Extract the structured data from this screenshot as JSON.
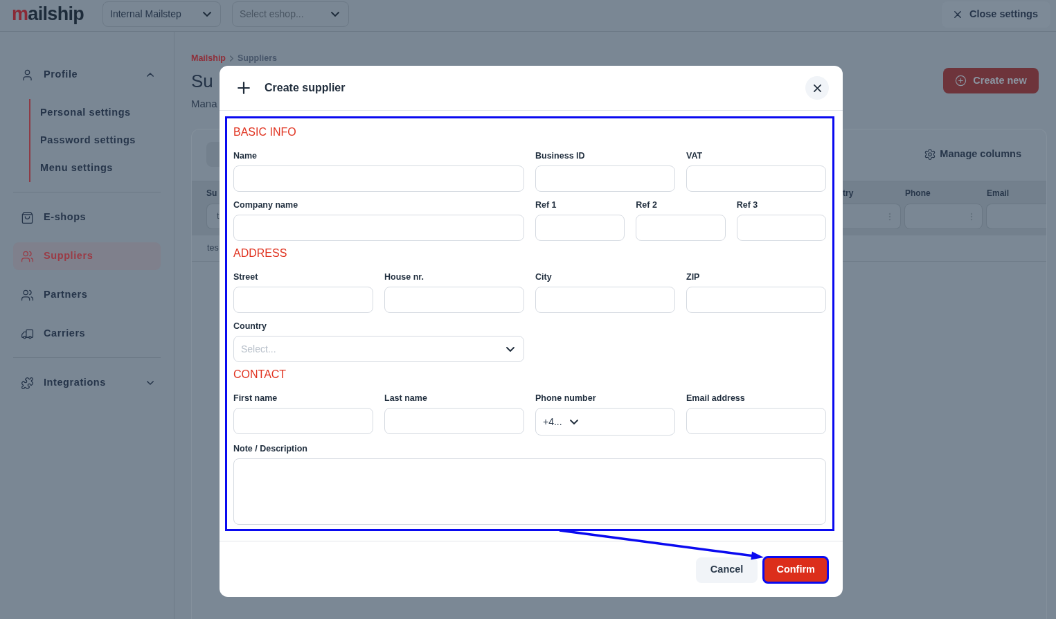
{
  "top_bar": {
    "logo": "mailship",
    "selects": [
      {
        "value": "Internal Mailstep"
      },
      {
        "placeholder": "Select eshop..."
      }
    ],
    "close_button": "Close settings"
  },
  "sidebar": {
    "sections": [
      {
        "items": [
          {
            "label": "Profile",
            "kind": "group",
            "expanded": true,
            "selected": false,
            "children": [
              {
                "label": "Personal settings",
                "selected": false
              },
              {
                "label": "Password settings",
                "selected": false
              },
              {
                "label": "Menu settings",
                "selected": false
              }
            ]
          }
        ]
      },
      {
        "items": [
          {
            "label": "E-shops",
            "kind": "link",
            "selected": false
          },
          {
            "label": "Suppliers",
            "kind": "link",
            "selected": true
          },
          {
            "label": "Partners",
            "kind": "link",
            "selected": false
          },
          {
            "label": "Carriers",
            "kind": "link",
            "selected": false
          }
        ]
      },
      {
        "items": [
          {
            "label": "Integrations",
            "kind": "group",
            "expanded": false,
            "selected": false
          }
        ]
      }
    ]
  },
  "page": {
    "breadcrumb": [
      {
        "label": "Mailship",
        "current": false
      },
      {
        "label": "Suppliers",
        "current": true
      }
    ],
    "title": "Su",
    "subtitle": "Mana",
    "create_button": "Create new",
    "manage_columns": "Manage columns",
    "table": {
      "left_columns": [
        {
          "label": "Su",
          "filter_value": "t"
        }
      ],
      "right_columns": [
        {
          "label": "try",
          "menu": true
        },
        {
          "label": "Phone",
          "menu": true
        },
        {
          "label": "Email",
          "menu": false
        }
      ],
      "rows": [
        {
          "cells": [
            "tes"
          ]
        }
      ]
    }
  },
  "modal": {
    "title": "Create supplier",
    "form_highlighted": true,
    "annotation_arrow": true,
    "sections": [
      {
        "heading": "BASIC INFO",
        "rows": [
          [
            {
              "label": "Name",
              "kind": "text"
            },
            {
              "label": "Business ID",
              "kind": "text"
            },
            {
              "label": "VAT",
              "kind": "text"
            }
          ],
          [
            {
              "label": "Company name",
              "kind": "text"
            },
            {
              "label": "Ref 1",
              "kind": "text"
            },
            {
              "label": "Ref 2",
              "kind": "text"
            },
            {
              "label": "Ref 3",
              "kind": "text"
            }
          ]
        ]
      },
      {
        "heading": "ADDRESS",
        "rows": [
          [
            {
              "label": "Street",
              "kind": "text"
            },
            {
              "label": "House nr.",
              "kind": "text"
            },
            {
              "label": "City",
              "kind": "text"
            },
            {
              "label": "ZIP",
              "kind": "text"
            }
          ],
          [
            {
              "label": "Country",
              "kind": "select",
              "placeholder": "Select..."
            }
          ]
        ]
      },
      {
        "heading": "CONTACT",
        "rows": [
          [
            {
              "label": "First name",
              "kind": "text"
            },
            {
              "label": "Last name",
              "kind": "text"
            },
            {
              "label": "Phone number",
              "kind": "phone",
              "value": "+4..."
            },
            {
              "label": "Email address",
              "kind": "text"
            }
          ],
          [
            {
              "label": "Note / Description",
              "kind": "textarea"
            }
          ]
        ]
      }
    ],
    "buttons": [
      {
        "label": "Cancel",
        "kind": "secondary",
        "highlighted": false
      },
      {
        "label": "Confirm",
        "kind": "primary",
        "highlighted": true
      }
    ]
  }
}
